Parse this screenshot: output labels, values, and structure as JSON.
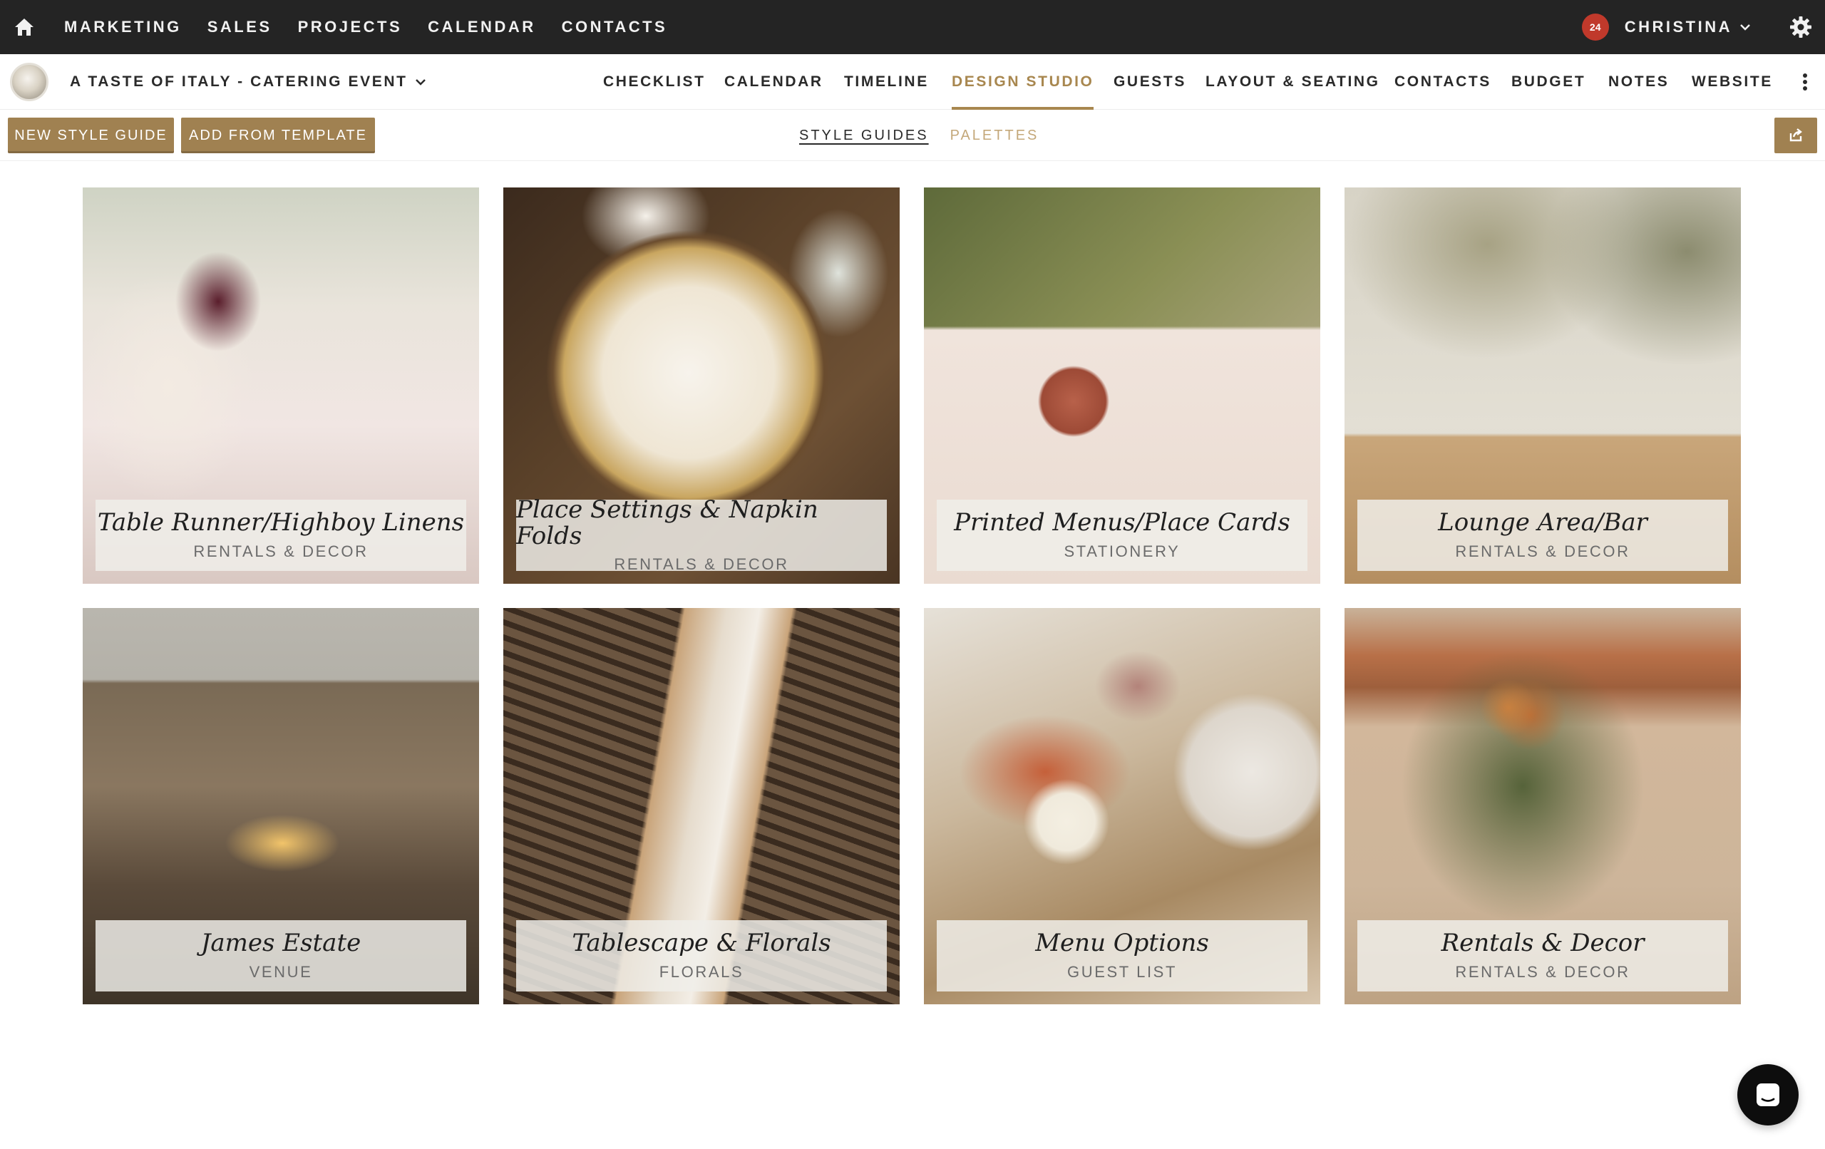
{
  "topbar": {
    "home_icon": "home-icon",
    "nav": [
      "MARKETING",
      "SALES",
      "PROJECTS",
      "CALENDAR",
      "CONTACTS"
    ],
    "notifications": "24",
    "user": "CHRISTINA",
    "settings_icon": "gear-icon"
  },
  "project": {
    "title": "A TASTE OF ITALY - CATERING EVENT",
    "tabs": [
      "CHECKLIST",
      "CALENDAR",
      "TIMELINE",
      "DESIGN STUDIO",
      "GUESTS",
      "LAYOUT & SEATING",
      "CONTACTS",
      "BUDGET",
      "NOTES",
      "WEBSITE"
    ],
    "active_tab": "DESIGN STUDIO"
  },
  "toolbar": {
    "new_style_guide": "NEW STYLE GUIDE",
    "add_from_template": "ADD FROM TEMPLATE",
    "view_tabs": [
      "STYLE GUIDES",
      "PALETTES"
    ],
    "active_view": "STYLE GUIDES",
    "share_icon": "share-icon"
  },
  "cards": [
    {
      "title": "Table Runner/Highboy Linens",
      "category": "RENTALS & DECOR"
    },
    {
      "title": "Place Settings & Napkin Folds",
      "category": "RENTALS & DECOR"
    },
    {
      "title": "Printed Menus/Place Cards",
      "category": "STATIONERY"
    },
    {
      "title": "Lounge Area/Bar",
      "category": "RENTALS & DECOR"
    },
    {
      "title": "James Estate",
      "category": "VENUE"
    },
    {
      "title": "Tablescape & Florals",
      "category": "FLORALS"
    },
    {
      "title": "Menu Options",
      "category": "GUEST LIST"
    },
    {
      "title": "Rentals & Decor",
      "category": "RENTALS & DECOR"
    }
  ],
  "chat_icon": "chat-icon",
  "colors": {
    "topbar": "#242424",
    "accent_gold": "#a8874f",
    "button_gold": "#a08151",
    "badge": "#c0392b"
  }
}
